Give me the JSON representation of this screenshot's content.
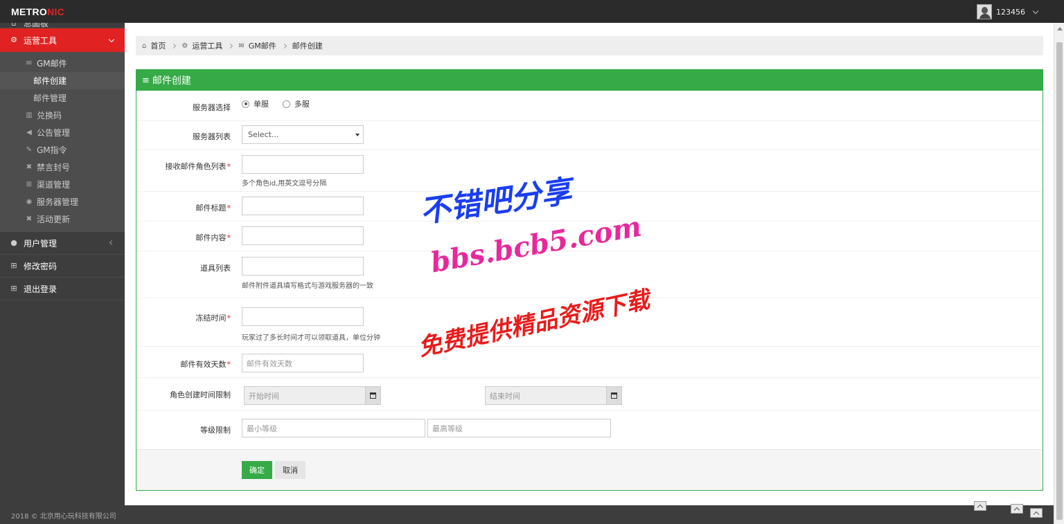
{
  "header": {
    "logo_main": "METRO",
    "logo_accent": "NIC",
    "username": "123456"
  },
  "sidebar": {
    "dashboard": "总面板",
    "ops_tools": "运营工具",
    "gm_mail": "GM邮件",
    "mail_create": "邮件创建",
    "mail_manage": "邮件管理",
    "redeem_code": "兑换码",
    "announcement": "公告管理",
    "gm_command": "GM指令",
    "ban": "禁言封号",
    "channel": "渠道管理",
    "server": "服务器管理",
    "activity": "活动更新",
    "user_manage": "用户管理",
    "change_password": "修改密码",
    "logout": "退出登录"
  },
  "footer": "2018 © 北京用心玩科技有限公司",
  "breadcrumb": {
    "home": "首页",
    "ops": "运营工具",
    "gm": "GM邮件",
    "current": "邮件创建"
  },
  "form": {
    "title": "邮件创建",
    "server_select_label": "服务器选择",
    "single_server": "单服",
    "multi_server": "多服",
    "server_list_label": "服务器列表",
    "server_list_value": "Select...",
    "receivers_label": "接收邮件角色列表",
    "receivers_hint": "多个角色id,用英文逗号分隔",
    "mail_title_label": "邮件标题",
    "mail_content_label": "邮件内容",
    "items_label": "道具列表",
    "items_hint": "邮件附件道具填写格式与游戏服务器的一致",
    "freeze_label": "冻结时间",
    "freeze_hint": "玩家过了多长时间才可以领取道具，单位分钟",
    "valid_days_label": "邮件有效天数",
    "valid_days_placeholder": "邮件有效天数",
    "role_time_label": "角色创建时间限制",
    "start_time_placeholder": "开始时间",
    "end_time_placeholder": "结束时间",
    "level_label": "等级限制",
    "min_level_placeholder": "最小等级",
    "max_level_placeholder": "最高等级",
    "required_mark": "*",
    "ok": "确定",
    "cancel": "取消"
  },
  "watermark": {
    "line1": "不错吧分享",
    "line2": "bbs.bcb5.com",
    "line3": "免费提供精品资源下载"
  }
}
